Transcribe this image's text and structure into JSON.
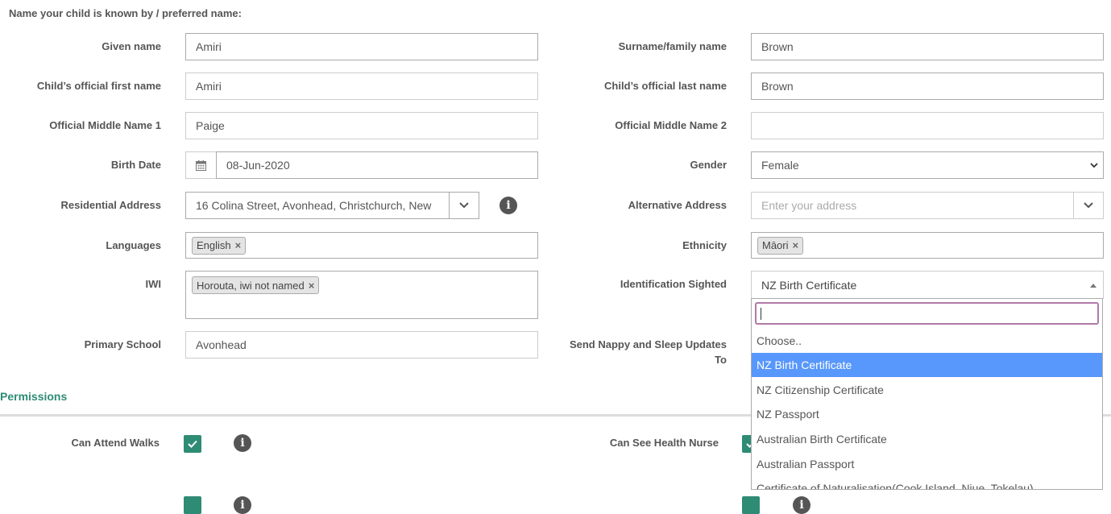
{
  "heading": "Name your child is known by / preferred name:",
  "left": {
    "given_name": {
      "label": "Given name",
      "value": "Amiri"
    },
    "official_first": {
      "label": "Child’s official first name",
      "value": "Amiri"
    },
    "middle1": {
      "label": "Official Middle Name 1",
      "value": "Paige"
    },
    "birth_date": {
      "label": "Birth Date",
      "value": "08-Jun-2020"
    },
    "address": {
      "label": "Residential Address",
      "value": "16 Colina Street, Avonhead, Christchurch, New"
    },
    "languages": {
      "label": "Languages",
      "tags": [
        "English"
      ]
    },
    "iwi": {
      "label": "IWI",
      "tags": [
        "Horouta, iwi not named"
      ]
    },
    "primary_school": {
      "label": "Primary School",
      "value": "Avonhead"
    }
  },
  "right": {
    "surname": {
      "label": "Surname/family name",
      "value": "Brown"
    },
    "official_last": {
      "label": "Child’s official last name",
      "value": "Brown"
    },
    "middle2": {
      "label": "Official Middle Name 2",
      "value": ""
    },
    "gender": {
      "label": "Gender",
      "value": "Female"
    },
    "alt_address": {
      "label": "Alternative Address",
      "placeholder": "Enter your address"
    },
    "ethnicity": {
      "label": "Ethnicity",
      "tags": [
        "Māori"
      ]
    },
    "identification": {
      "label": "Identification Sighted",
      "value": "NZ Birth Certificate",
      "options": [
        "Choose..",
        "NZ Birth Certificate",
        "NZ Citizenship Certificate",
        "NZ Passport",
        "Australian Birth Certificate",
        "Australian Passport",
        "Certificate of Naturalisation(Cook Island, Niue, Tokelau)"
      ],
      "selected_index": 1
    },
    "nappy_updates": {
      "label_line1": "Send Nappy and Sleep Updates",
      "label_line2": "To"
    }
  },
  "permissions": {
    "title": "Permissions",
    "can_attend_walks": {
      "label": "Can Attend Walks",
      "checked": true
    },
    "can_see_health_nurse": {
      "label": "Can See Health Nurse",
      "checked": true
    }
  },
  "colors": {
    "accent": "#2e8b74",
    "highlight": "#5897fb",
    "focus": "#b07aa8"
  }
}
